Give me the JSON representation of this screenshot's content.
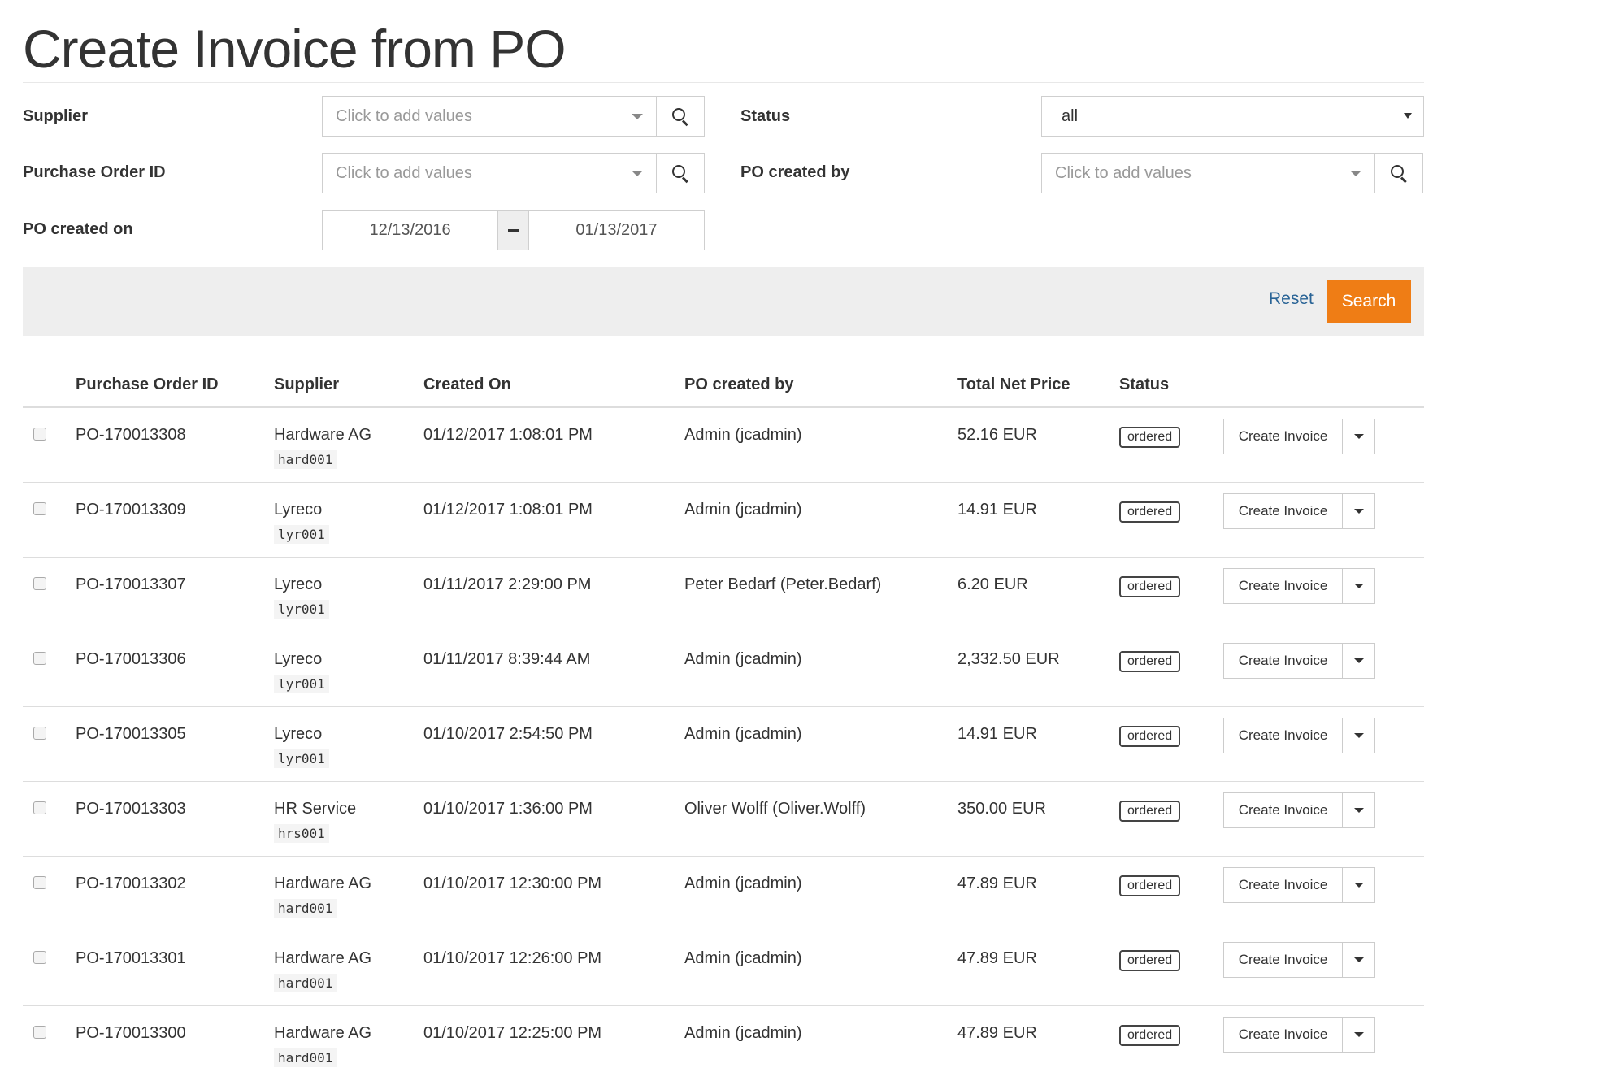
{
  "page": {
    "title": "Create Invoice from PO"
  },
  "filters": {
    "supplier": {
      "label": "Supplier",
      "placeholder": "Click to add values"
    },
    "purchase_order_id": {
      "label": "Purchase Order ID",
      "placeholder": "Click to add values"
    },
    "po_created_on": {
      "label": "PO created on",
      "from": "12/13/2016",
      "to": "01/13/2017"
    },
    "status": {
      "label": "Status",
      "value": "all"
    },
    "po_created_by": {
      "label": "PO created by",
      "placeholder": "Click to add values"
    }
  },
  "actions": {
    "reset_label": "Reset",
    "search_label": "Search",
    "search_color": "#ef7d15"
  },
  "table": {
    "columns": [
      "Purchase Order ID",
      "Supplier",
      "Created On",
      "PO created by",
      "Total Net Price",
      "Status"
    ],
    "rows": [
      {
        "id": "PO-170013308",
        "supplier": "Hardware AG",
        "supplier_code": "hard001",
        "created_on": "01/12/2017 1:08:01 PM",
        "created_by": "Admin (jcadmin)",
        "net_price": "52.16 EUR",
        "status": "ordered",
        "action": "Create Invoice"
      },
      {
        "id": "PO-170013309",
        "supplier": "Lyreco",
        "supplier_code": "lyr001",
        "created_on": "01/12/2017 1:08:01 PM",
        "created_by": "Admin (jcadmin)",
        "net_price": "14.91 EUR",
        "status": "ordered",
        "action": "Create Invoice"
      },
      {
        "id": "PO-170013307",
        "supplier": "Lyreco",
        "supplier_code": "lyr001",
        "created_on": "01/11/2017 2:29:00 PM",
        "created_by": "Peter Bedarf (Peter.Bedarf)",
        "net_price": "6.20 EUR",
        "status": "ordered",
        "action": "Create Invoice"
      },
      {
        "id": "PO-170013306",
        "supplier": "Lyreco",
        "supplier_code": "lyr001",
        "created_on": "01/11/2017 8:39:44 AM",
        "created_by": "Admin (jcadmin)",
        "net_price": "2,332.50 EUR",
        "status": "ordered",
        "action": "Create Invoice"
      },
      {
        "id": "PO-170013305",
        "supplier": "Lyreco",
        "supplier_code": "lyr001",
        "created_on": "01/10/2017 2:54:50 PM",
        "created_by": "Admin (jcadmin)",
        "net_price": "14.91 EUR",
        "status": "ordered",
        "action": "Create Invoice"
      },
      {
        "id": "PO-170013303",
        "supplier": "HR Service",
        "supplier_code": "hrs001",
        "created_on": "01/10/2017 1:36:00 PM",
        "created_by": "Oliver Wolff (Oliver.Wolff)",
        "net_price": "350.00 EUR",
        "status": "ordered",
        "action": "Create Invoice"
      },
      {
        "id": "PO-170013302",
        "supplier": "Hardware AG",
        "supplier_code": "hard001",
        "created_on": "01/10/2017 12:30:00 PM",
        "created_by": "Admin (jcadmin)",
        "net_price": "47.89 EUR",
        "status": "ordered",
        "action": "Create Invoice"
      },
      {
        "id": "PO-170013301",
        "supplier": "Hardware AG",
        "supplier_code": "hard001",
        "created_on": "01/10/2017 12:26:00 PM",
        "created_by": "Admin (jcadmin)",
        "net_price": "47.89 EUR",
        "status": "ordered",
        "action": "Create Invoice"
      },
      {
        "id": "PO-170013300",
        "supplier": "Hardware AG",
        "supplier_code": "hard001",
        "created_on": "01/10/2017 12:25:00 PM",
        "created_by": "Admin (jcadmin)",
        "net_price": "47.89 EUR",
        "status": "ordered",
        "action": "Create Invoice"
      }
    ]
  }
}
